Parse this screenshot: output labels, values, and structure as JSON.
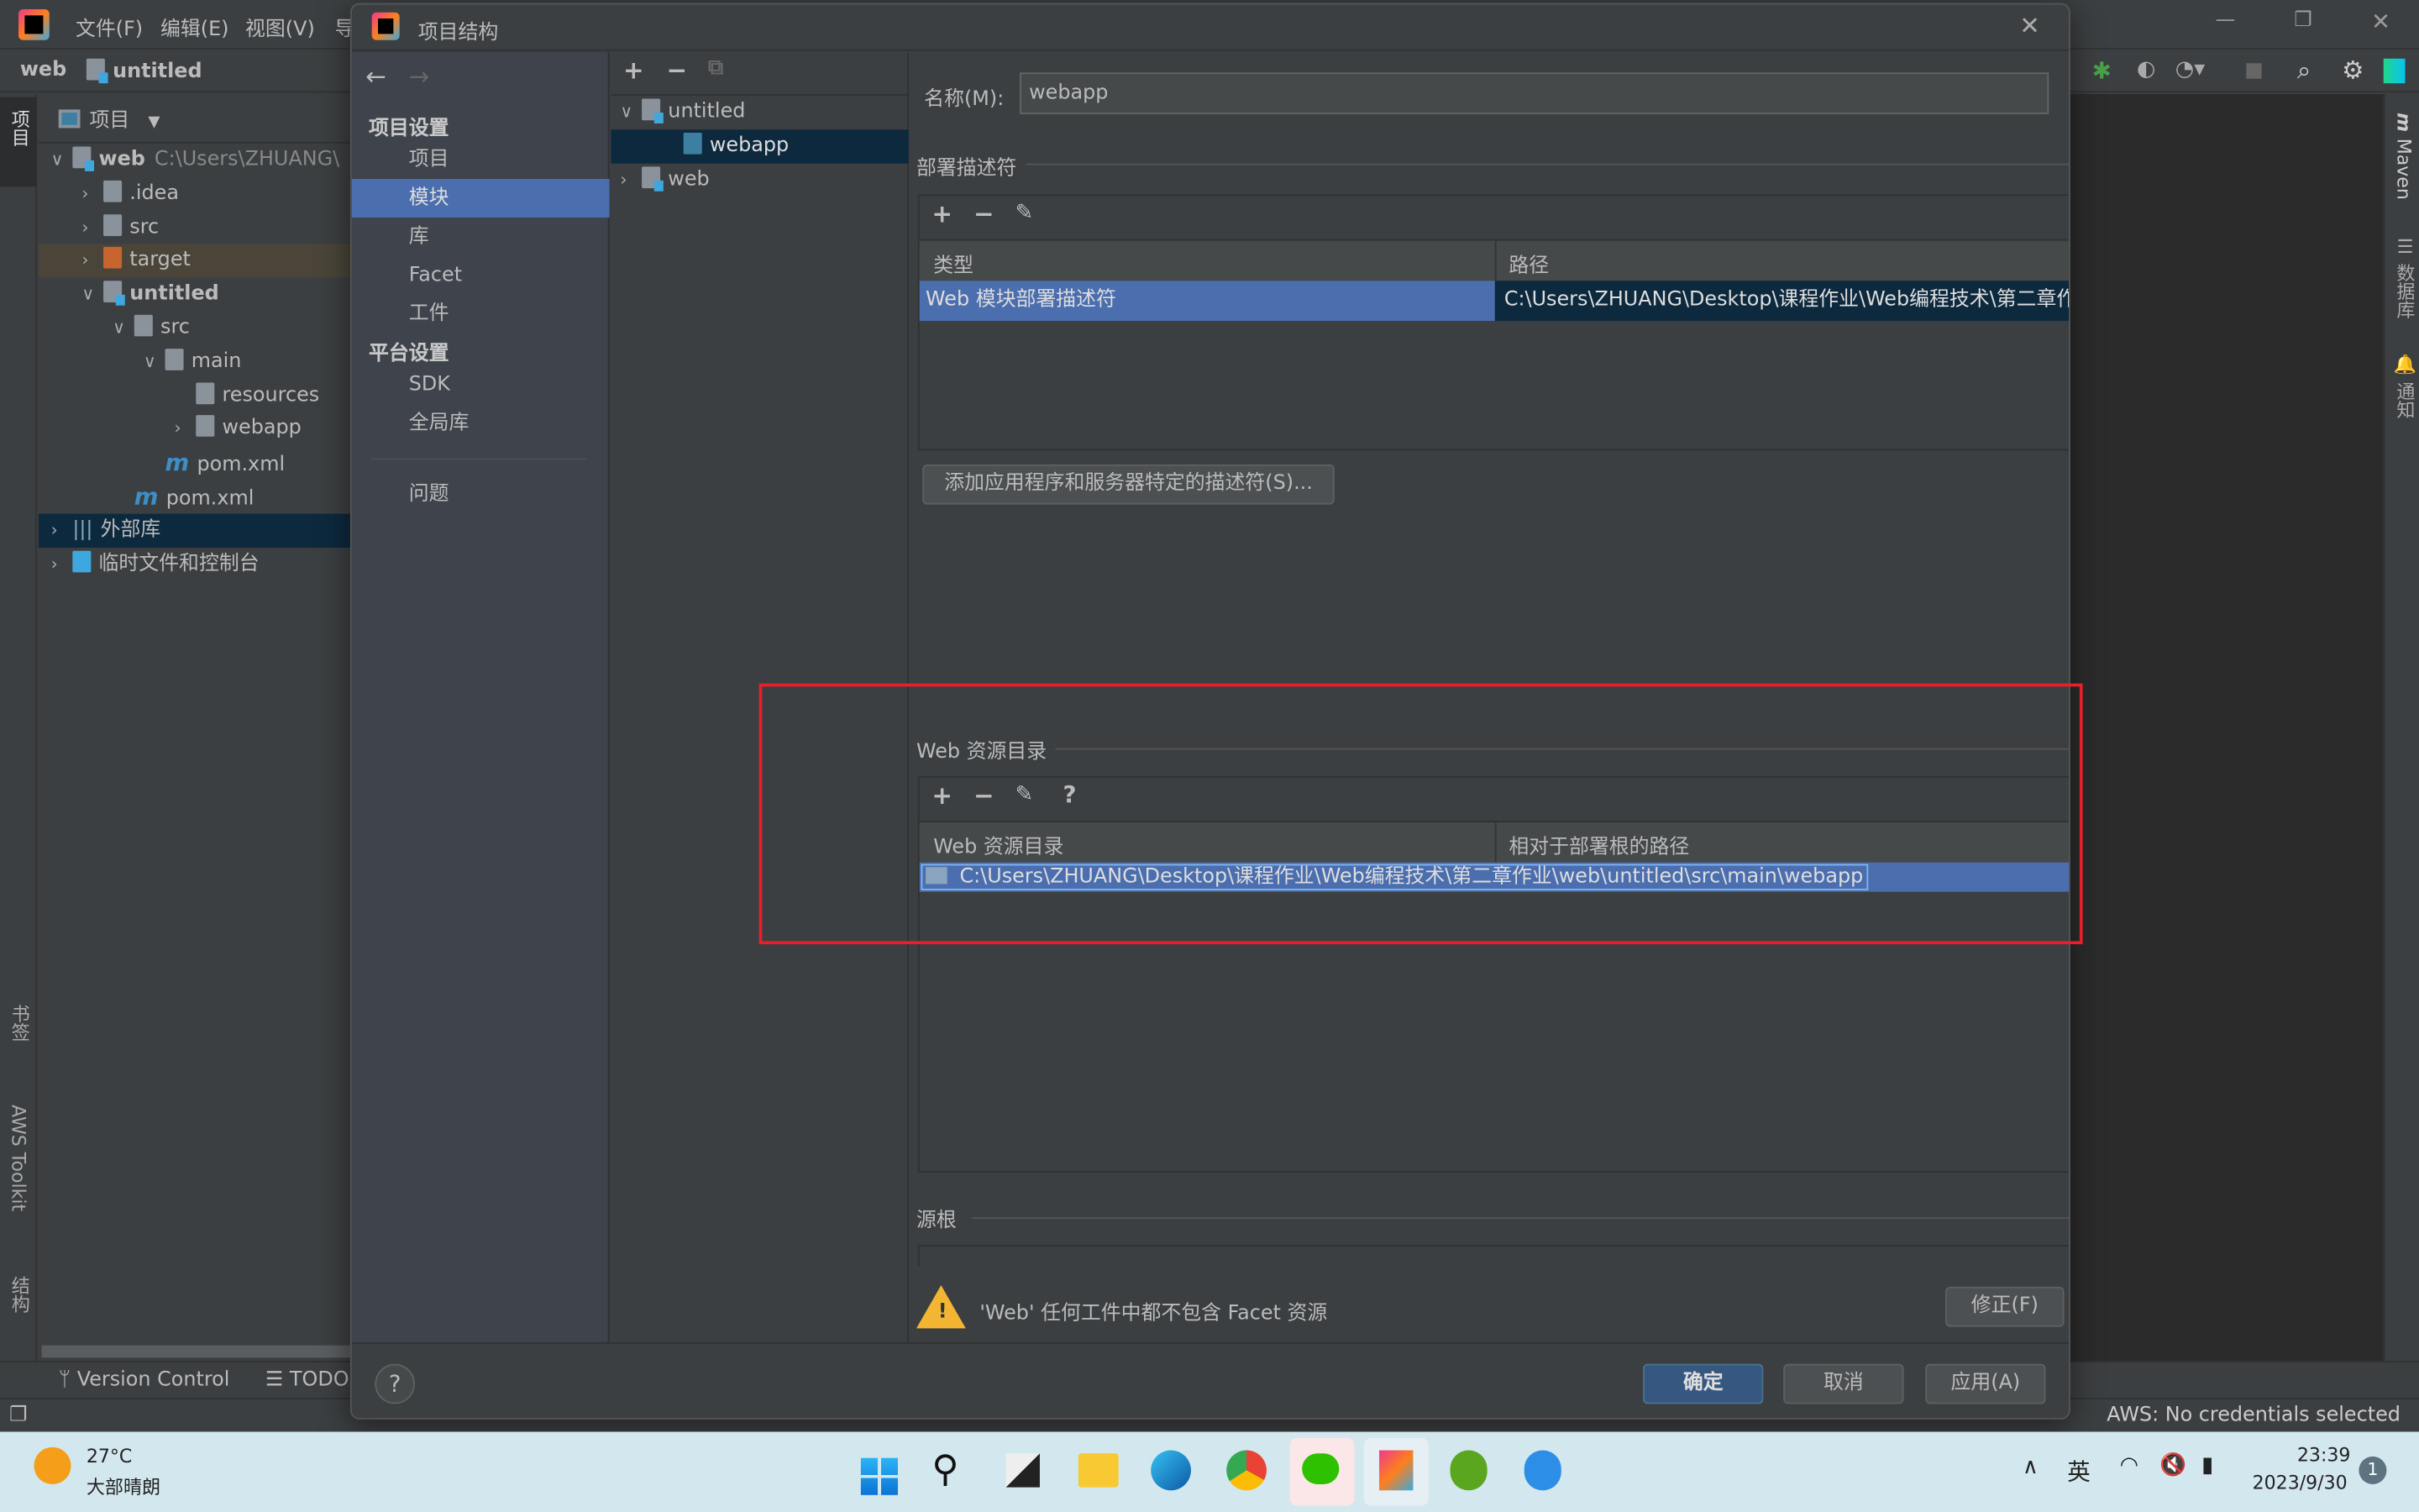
{
  "ide": {
    "menu": [
      "文件(F)",
      "编辑(E)",
      "视图(V)",
      "导"
    ],
    "breadcrumb": [
      "web",
      "untitled"
    ],
    "project_panel": {
      "title": "项目",
      "tree": [
        {
          "label": "web",
          "hint": "C:\\Users\\ZHUANG\\",
          "level": 0,
          "expanded": true,
          "bold": true
        },
        {
          "label": ".idea",
          "level": 1
        },
        {
          "label": "src",
          "level": 1
        },
        {
          "label": "target",
          "level": 1,
          "highlighted": true
        },
        {
          "label": "untitled",
          "level": 1,
          "expanded": true,
          "bold": true
        },
        {
          "label": "src",
          "level": 2,
          "expanded": true
        },
        {
          "label": "main",
          "level": 3,
          "expanded": true
        },
        {
          "label": "resources",
          "level": 4
        },
        {
          "label": "webapp",
          "level": 4
        },
        {
          "label": "pom.xml",
          "level": 3,
          "file": "maven"
        },
        {
          "label": "pom.xml",
          "level": 2,
          "file": "maven"
        },
        {
          "label": "外部库",
          "level": 0,
          "selected": true
        },
        {
          "label": "临时文件和控制台",
          "level": 0
        }
      ]
    },
    "left_strip": [
      "项目",
      "书签",
      "AWS Toolkit",
      "结构"
    ],
    "right_strip": [
      "Maven",
      "数据库",
      "通知"
    ],
    "bottom_tabs": [
      "Version Control",
      "TODO"
    ],
    "status": "AWS: No credentials selected"
  },
  "dialog": {
    "title": "项目结构",
    "nav": {
      "section1": "项目设置",
      "items1": [
        "项目",
        "模块",
        "库",
        "Facet",
        "工件"
      ],
      "section2": "平台设置",
      "items2": [
        "SDK",
        "全局库"
      ],
      "problems": "问题",
      "selected": "模块"
    },
    "modules": [
      {
        "label": "untitled",
        "expanded": true
      },
      {
        "label": "webapp",
        "child": true,
        "selected": true
      },
      {
        "label": "web"
      }
    ],
    "name_label": "名称(M):",
    "name_value": "webapp",
    "deploy": {
      "title": "部署描述符",
      "columns": [
        "类型",
        "路径"
      ],
      "row": [
        "Web 模块部署描述符",
        "C:\\Users\\ZHUANG\\Desktop\\课程作业\\Web编程技术\\第二章作"
      ],
      "add_button": "添加应用程序和服务器特定的描述符(S)..."
    },
    "web_resources": {
      "title": "Web 资源目录",
      "columns": [
        "Web 资源目录",
        "相对于部署根的路径"
      ],
      "row": [
        "C:\\Users\\ZHUANG\\Desktop\\课程作业\\Web编程技术\\第二章作业\\web\\untitled\\src\\main\\webapp",
        ""
      ]
    },
    "source_roots": "源根",
    "warning": "'Web' 任何工件中都不包含 Facet 资源",
    "fix_button": "修正(F)",
    "ok": "确定",
    "cancel": "取消",
    "apply": "应用(A)",
    "highlight_color": "#e8202a"
  },
  "taskbar": {
    "weather_temp": "27°C",
    "weather_desc": "大部晴朗",
    "ime": "英",
    "time": "23:39",
    "date": "2023/9/30",
    "notifications": "1"
  }
}
